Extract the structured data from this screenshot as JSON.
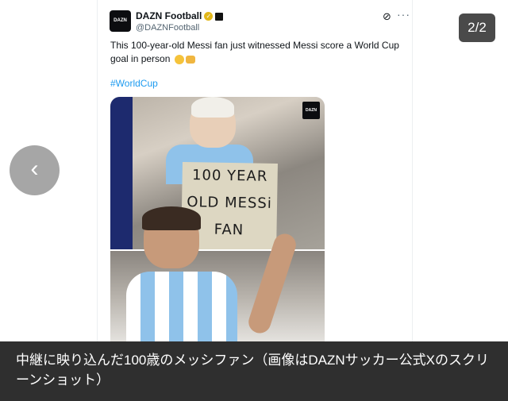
{
  "tweet": {
    "avatar_label": "DAZN",
    "author_name": "DAZN Football",
    "author_handle": "@DAZNFootball",
    "text": "This 100-year-old Messi fan just witnessed Messi score a World Cup goal in person",
    "hashtag": "#WorldCup",
    "photo_watermark": "DAZN",
    "sign_lines": [
      "100 YEAR",
      "OLD MESSi",
      "FAN"
    ]
  },
  "icons": {
    "verified": "verified-badge-icon",
    "affiliate": "affiliate-badge-icon",
    "grok": "grok-icon",
    "more": "more-options-icon",
    "prev": "chevron-left-icon"
  },
  "viewer": {
    "counter": "2/2",
    "prev_glyph": "‹"
  },
  "caption": "中継に映り込んだ100歳のメッシファン（画像はDAZNサッカー公式Xのスクリーンショット）"
}
